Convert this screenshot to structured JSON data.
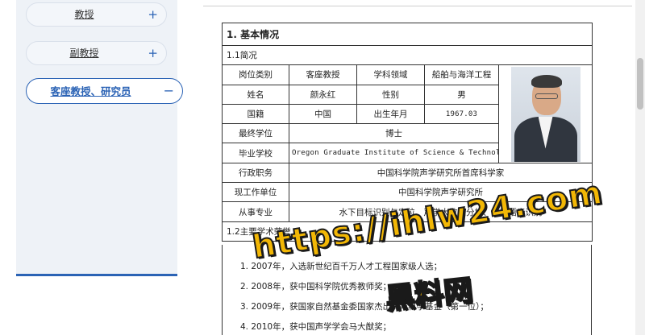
{
  "sidebar": {
    "items": [
      {
        "label": "教授",
        "icon": "+"
      },
      {
        "label": "副教授",
        "icon": "+"
      },
      {
        "label": "客座教授、研究员",
        "icon": "−"
      }
    ]
  },
  "profile": {
    "section_title": "1. 基本情况",
    "subsection_intro": "1.1简况",
    "rows": {
      "position_type_label": "岗位类别",
      "position_type_value": "客座教授",
      "field_label": "学科领域",
      "field_value": "船舶与海洋工程",
      "name_label": "姓名",
      "name_value": "颜永红",
      "gender_label": "性别",
      "gender_value": "男",
      "nationality_label": "国籍",
      "nationality_value": "中国",
      "birth_label": "出生年月",
      "birth_value": "1967.03",
      "degree_label": "最终学位",
      "degree_value": "博士",
      "school_label": "毕业学校",
      "school_value": "Oregon Graduate Institute of Science & Technology",
      "admin_label": "行政职务",
      "admin_value": "中国科学院声学研究所首席科学家",
      "unit_label": "现工作单位",
      "unit_value": "中国科学院声学研究所",
      "specialty_label": "从事专业",
      "specialty_value": "水下目标识别与定位、声学大数据分析、自动语音识别"
    },
    "subsection_honors": "1.2主要学术荣誉",
    "honors": [
      "1. 2007年，入选新世纪百千万人才工程国家级人选；",
      "2. 2008年，获中国科学院优秀教师奖；",
      "3. 2009年，获国家自然基金委国家杰出青年科学基金（第一位）；",
      "4. 2010年，获中国声学学会马大猷奖；"
    ]
  },
  "watermark": {
    "url": "https://ihlw24.com",
    "cn": "黑料网"
  },
  "colors": {
    "accent": "#2b63b5",
    "sidebar_bg": "#eef2f7",
    "watermark_fill": "#f2b705"
  }
}
